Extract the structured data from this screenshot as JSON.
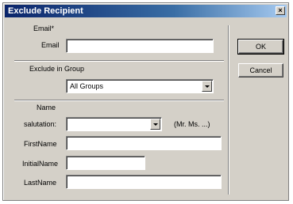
{
  "window": {
    "title": "Exclude Recipient",
    "close_glyph": "×"
  },
  "email_section": {
    "heading": "Email*",
    "email_label": "Email",
    "email_value": ""
  },
  "group_section": {
    "heading": "Exclude in Group",
    "group_selected": "All Groups"
  },
  "name_section": {
    "heading": "Name",
    "salutation_label": "salutation:",
    "salutation_value": "",
    "salutation_hint": "(Mr. Ms. ...)",
    "firstname_label": "FirstName",
    "firstname_value": "",
    "initialname_label": "InitialName",
    "initialname_value": "",
    "lastname_label": "LastName",
    "lastname_value": ""
  },
  "buttons": {
    "ok": "OK",
    "cancel": "Cancel"
  }
}
